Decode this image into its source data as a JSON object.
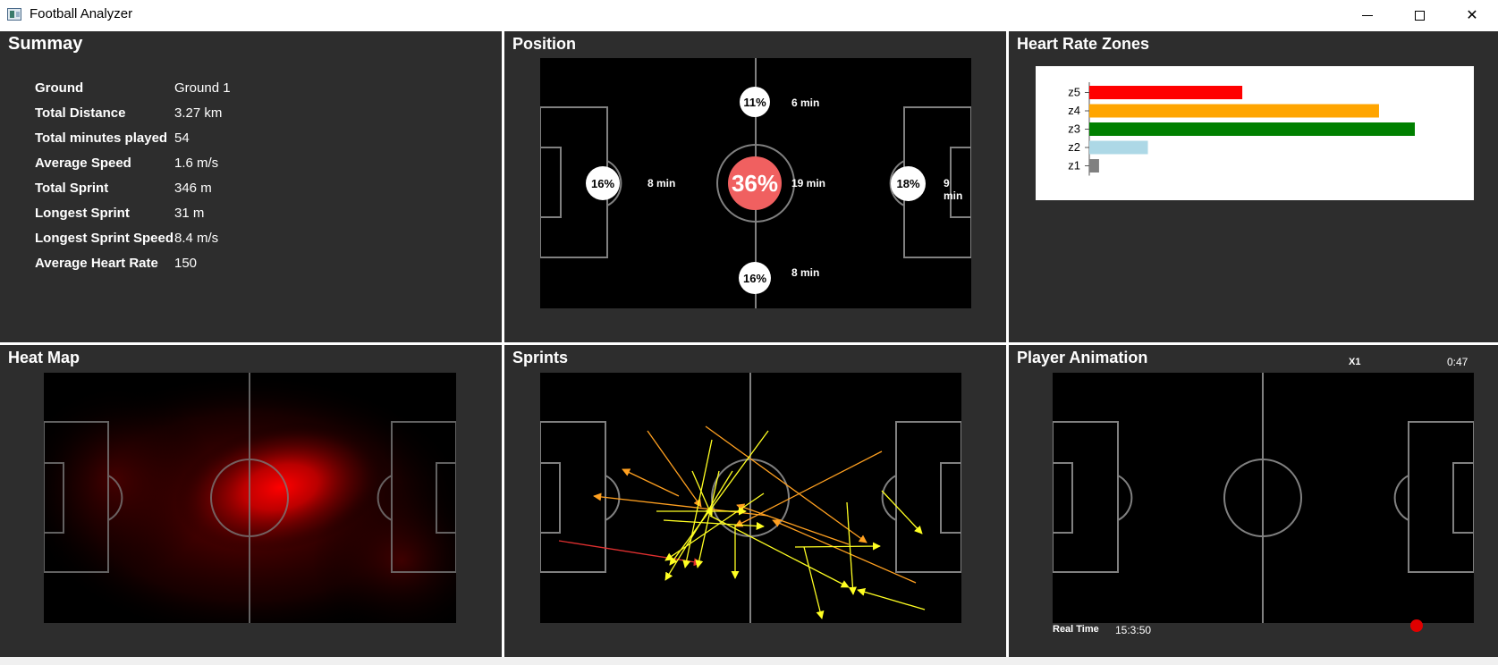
{
  "window": {
    "title": "Football Analyzer"
  },
  "summary": {
    "title": "Summay",
    "rows": [
      {
        "label": "Ground",
        "value": "Ground 1"
      },
      {
        "label": "Total Distance",
        "value": "3.27 km"
      },
      {
        "label": "Total minutes played",
        "value": "54"
      },
      {
        "label": "Average Speed",
        "value": "1.6 m/s"
      },
      {
        "label": "Total Sprint",
        "value": "346 m"
      },
      {
        "label": "Longest Sprint",
        "value": "31 m"
      },
      {
        "label": "Longest Sprint Speed",
        "value": "8.4 m/s"
      },
      {
        "label": "Average Heart Rate",
        "value": "150"
      }
    ]
  },
  "position": {
    "title": "Position",
    "zones": {
      "top": {
        "pct": "11%",
        "mins": "6 min"
      },
      "left": {
        "pct": "16%",
        "mins": "8 min"
      },
      "center": {
        "pct": "36%",
        "mins": "19 min"
      },
      "right": {
        "pct": "18%",
        "mins": "9 min"
      },
      "bottom": {
        "pct": "16%",
        "mins": "8 min"
      }
    }
  },
  "heart_rate_zones": {
    "title": "Heart Rate Zones",
    "chart_data": {
      "type": "bar",
      "orientation": "horizontal",
      "categories": [
        "z5",
        "z4",
        "z3",
        "z2",
        "z1"
      ],
      "values": [
        47,
        89,
        100,
        18,
        3
      ],
      "colors": [
        "#ff0000",
        "#ffa500",
        "#008000",
        "#add8e6",
        "#808080"
      ],
      "xlim": [
        0,
        100
      ],
      "grid": false
    }
  },
  "heat_map": {
    "title": "Heat Map"
  },
  "sprints": {
    "title": "Sprints",
    "colors": {
      "short": "#ffff22",
      "medium": "#ffa020",
      "long": "#e03030"
    }
  },
  "player_animation": {
    "title": "Player Animation",
    "speed": "X1",
    "clock": "0:47",
    "real_time_label": "Real Time",
    "real_time_value": "15:3:50",
    "marker_color": "#e00000"
  },
  "colors": {
    "panel_bg": "#2d2d2d",
    "field_bg": "#000000",
    "line": "#808080"
  }
}
